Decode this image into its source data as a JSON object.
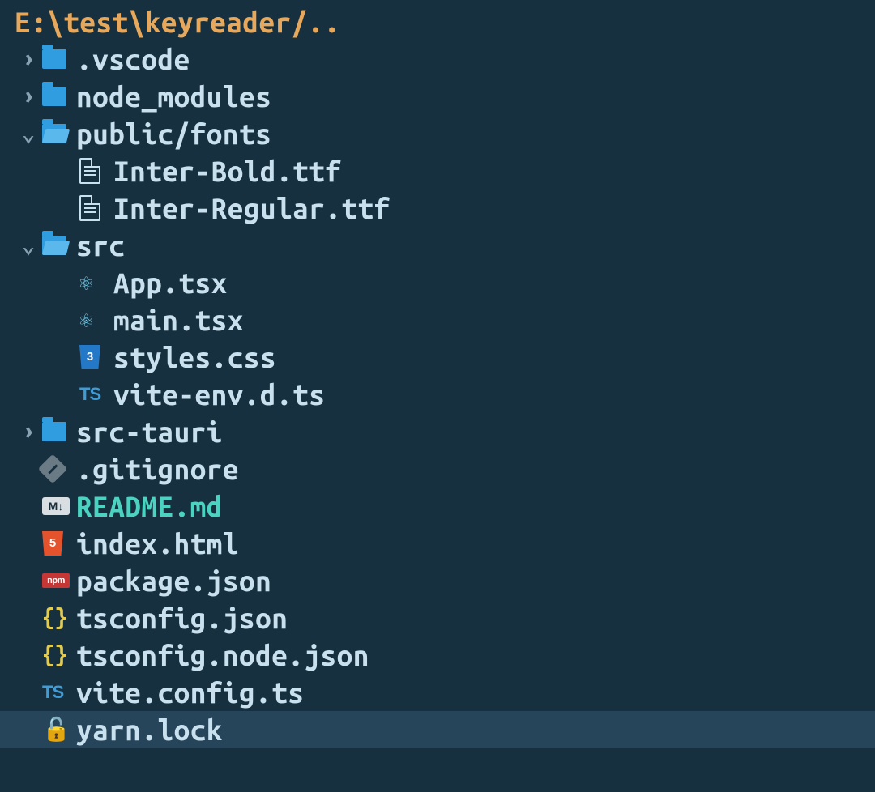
{
  "root_path": "E:\\test\\keyreader/..",
  "rows": [
    {
      "chev": "right",
      "indent": 0,
      "icon": "folder-closed",
      "label": ".vscode",
      "selected": false
    },
    {
      "chev": "right",
      "indent": 0,
      "icon": "folder-closed",
      "label": "node_modules",
      "selected": false
    },
    {
      "chev": "down",
      "indent": 0,
      "icon": "folder-open",
      "label": "public/fonts",
      "selected": false
    },
    {
      "chev": "",
      "indent": 1,
      "icon": "file",
      "label": "Inter-Bold.ttf",
      "selected": false
    },
    {
      "chev": "",
      "indent": 1,
      "icon": "file",
      "label": "Inter-Regular.ttf",
      "selected": false
    },
    {
      "chev": "down",
      "indent": 0,
      "icon": "folder-open",
      "label": "src",
      "selected": false
    },
    {
      "chev": "",
      "indent": 1,
      "icon": "react",
      "label": "App.tsx",
      "selected": false
    },
    {
      "chev": "",
      "indent": 1,
      "icon": "react",
      "label": "main.tsx",
      "selected": false
    },
    {
      "chev": "",
      "indent": 1,
      "icon": "css",
      "label": "styles.css",
      "selected": false
    },
    {
      "chev": "",
      "indent": 1,
      "icon": "ts",
      "label": "vite-env.d.ts",
      "selected": false
    },
    {
      "chev": "right",
      "indent": 0,
      "icon": "folder-closed",
      "label": "src-tauri",
      "selected": false
    },
    {
      "chev": "",
      "indent": 0,
      "icon": "git",
      "label": ".gitignore",
      "selected": false
    },
    {
      "chev": "",
      "indent": 0,
      "icon": "md",
      "label": "README.md",
      "selected": false,
      "label_color": "teal"
    },
    {
      "chev": "",
      "indent": 0,
      "icon": "html",
      "label": "index.html",
      "selected": false
    },
    {
      "chev": "",
      "indent": 0,
      "icon": "npm",
      "label": "package.json",
      "selected": false
    },
    {
      "chev": "",
      "indent": 0,
      "icon": "json",
      "label": "tsconfig.json",
      "selected": false
    },
    {
      "chev": "",
      "indent": 0,
      "icon": "json",
      "label": "tsconfig.node.json",
      "selected": false
    },
    {
      "chev": "",
      "indent": 0,
      "icon": "ts",
      "label": "vite.config.ts",
      "selected": false
    },
    {
      "chev": "",
      "indent": 0,
      "icon": "lock",
      "label": "yarn.lock",
      "selected": true
    }
  ],
  "icon_text": {
    "css": "3",
    "html": "5",
    "ts": "TS",
    "md": "M↓",
    "npm": "npm",
    "json": "{}",
    "react": "⚛",
    "lock": "🔓"
  }
}
